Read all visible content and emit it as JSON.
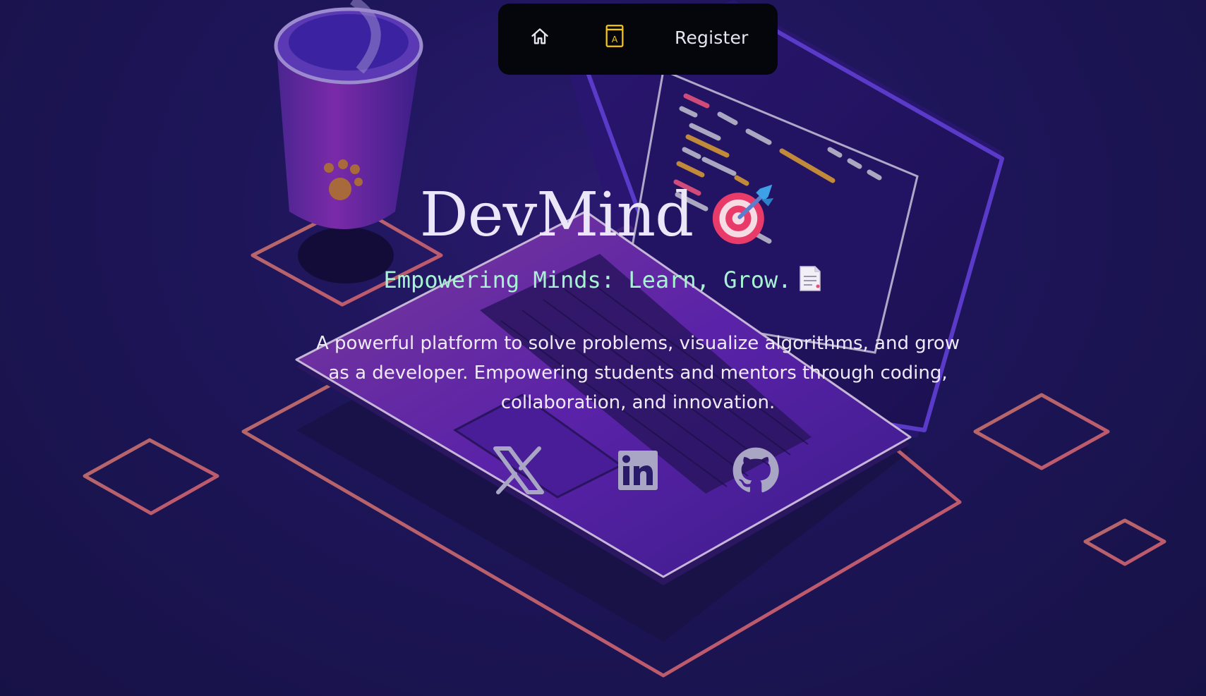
{
  "nav": {
    "home_icon": "home-icon",
    "book_icon": "dictionary-book-icon",
    "register_label": "Register"
  },
  "hero": {
    "title": "DevMind",
    "title_icon": "direct-hit-target-icon",
    "tagline": "Empowering Minds: Learn, Grow.",
    "tagline_icon": "document-icon",
    "description": "A powerful platform to solve problems, visualize algorithms, and grow as a developer. Empowering students and mentors through coding, collaboration, and innovation."
  },
  "socials": {
    "x_icon": "x-twitter-icon",
    "linkedin_icon": "linkedin-icon",
    "github_icon": "github-icon"
  },
  "colors": {
    "background": "#1d1558",
    "navbar": "#04060c",
    "title": "#ebe6f8",
    "tagline": "#a8f2d4",
    "accent_book": "#f5c518",
    "social_icons": "#a8a6c4"
  }
}
